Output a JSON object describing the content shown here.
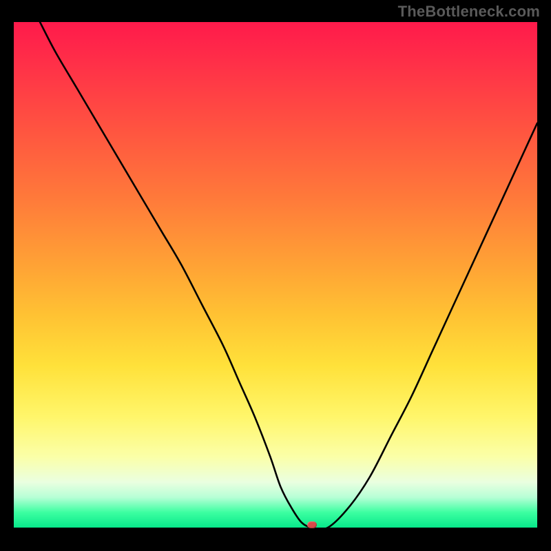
{
  "watermark": "TheBottleneck.com",
  "chart_data": {
    "type": "line",
    "title": "",
    "xlabel": "",
    "ylabel": "",
    "xlim": [
      0,
      100
    ],
    "ylim": [
      0,
      100
    ],
    "grid": false,
    "legend": false,
    "background_gradient": {
      "top": "#ff1a4b",
      "upper_mid": "#ffa235",
      "lower_mid": "#fff66a",
      "bottom": "#07e88a"
    },
    "series": [
      {
        "name": "curve",
        "color": "#000000",
        "x": [
          5,
          8,
          12,
          16,
          20,
          24,
          28,
          32,
          36,
          40,
          43,
          46,
          49,
          51,
          53,
          55,
          57,
          60,
          64,
          68,
          72,
          76,
          80,
          84,
          88,
          92,
          96,
          100
        ],
        "y": [
          100,
          94,
          87,
          80,
          73,
          66,
          59,
          52,
          44,
          36,
          29,
          22,
          14,
          8,
          4,
          1,
          0,
          0,
          4,
          10,
          18,
          26,
          35,
          44,
          53,
          62,
          71,
          80
        ]
      }
    ],
    "marker": {
      "x": 57,
      "y": 0,
      "color": "#d84a4a",
      "shape": "rounded-rect"
    }
  }
}
